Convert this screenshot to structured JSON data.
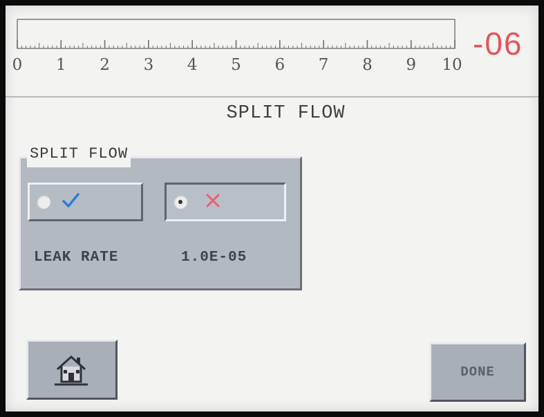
{
  "scale": {
    "ticks": [
      "0",
      "1",
      "2",
      "3",
      "4",
      "5",
      "6",
      "7",
      "8",
      "9",
      "10"
    ],
    "value": "-06",
    "value_color": "#e4545a"
  },
  "page": {
    "title": "SPLIT FLOW"
  },
  "split_flow_group": {
    "label": "SPLIT FLOW",
    "options": [
      {
        "icon": "check-icon",
        "icon_color": "#2a7ed8",
        "selected": false
      },
      {
        "icon": "cross-icon",
        "icon_color": "#ef5a6e",
        "selected": true
      }
    ],
    "leak_rate_label": "LEAK RATE",
    "leak_rate_value": "1.0E-05"
  },
  "footer": {
    "home_icon": "home-icon",
    "done_label": "DONE"
  }
}
